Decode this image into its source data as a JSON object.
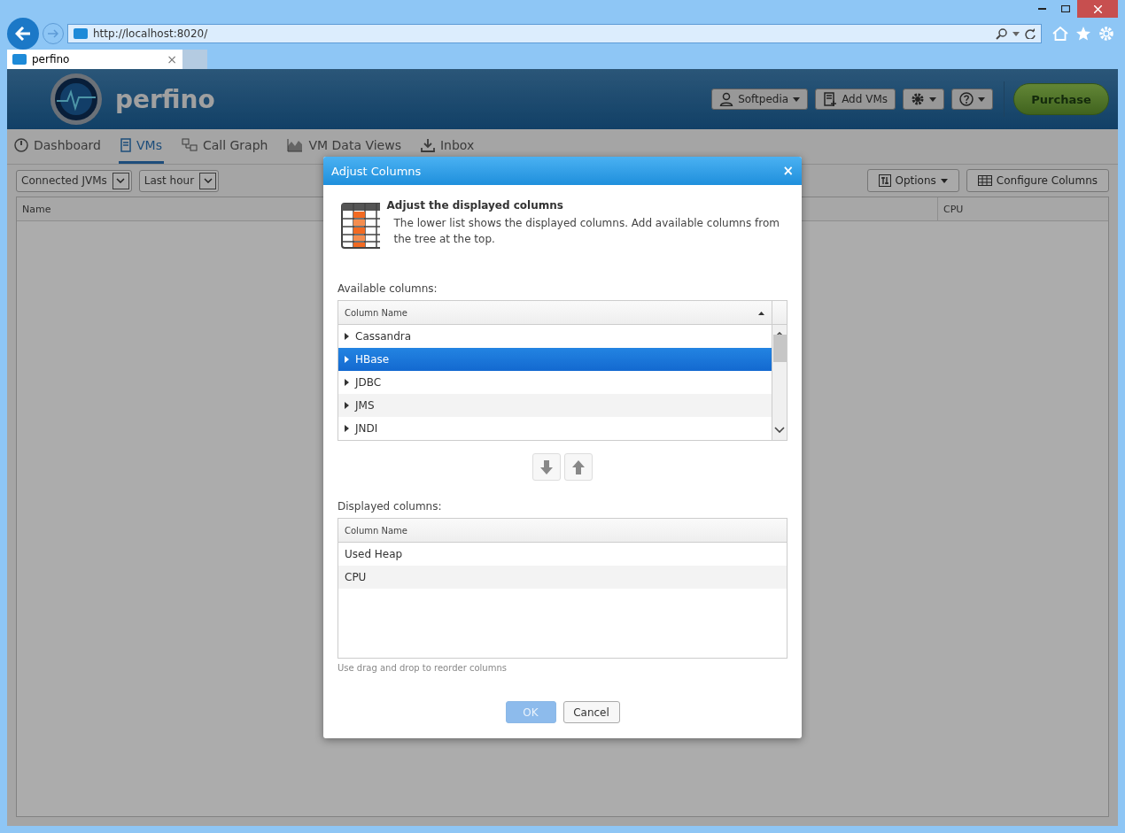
{
  "browser": {
    "address": "http://localhost:8020/",
    "tab": {
      "title": "perfino",
      "close": "×"
    }
  },
  "header": {
    "logo": "perfino",
    "buttons": [
      {
        "kind": "user",
        "label": "Softpedia",
        "dropdown": true
      },
      {
        "kind": "add",
        "label": "Add VMs",
        "dropdown": false
      },
      {
        "kind": "settings",
        "dropdown": true
      },
      {
        "kind": "help",
        "dropdown": true
      }
    ],
    "purchase": "Purchase"
  },
  "nav": [
    {
      "kind": "dashboard",
      "label": "Dashboard",
      "selected": false
    },
    {
      "kind": "vms",
      "label": "VMs",
      "selected": true
    },
    {
      "kind": "callgraph",
      "label": "Call Graph",
      "selected": false
    },
    {
      "kind": "dataviews",
      "label": "VM Data Views",
      "selected": false
    },
    {
      "kind": "inbox",
      "label": "Inbox",
      "selected": false
    }
  ],
  "toolbar": {
    "selects": [
      "Connected JVMs",
      "Last hour"
    ],
    "buttons": [
      {
        "kind": "options",
        "label": "Options",
        "dropdown": true
      },
      {
        "kind": "columns",
        "label": "Configure Columns",
        "dropdown": false
      }
    ]
  },
  "table": {
    "columns": [
      "Name",
      "CPU"
    ]
  },
  "dialog": {
    "title": "Adjust Columns",
    "close": "×",
    "heading": "Adjust the displayed columns",
    "description": "The lower list shows the displayed columns. Add available columns from the tree at the top.",
    "available": {
      "label": "Available columns:",
      "header": "Column Name",
      "rows": [
        {
          "label": "Cassandra",
          "selected": false,
          "expanded": false
        },
        {
          "label": "HBase",
          "selected": true,
          "expanded": false
        },
        {
          "label": "JDBC",
          "selected": false,
          "expanded": false
        },
        {
          "label": "JMS",
          "selected": false,
          "expanded": false
        },
        {
          "label": "JNDI",
          "selected": false,
          "expanded": false
        }
      ]
    },
    "displayed": {
      "label": "Displayed columns:",
      "header": "Column Name",
      "rows": [
        {
          "label": "Used Heap"
        },
        {
          "label": "CPU"
        }
      ]
    },
    "hint": "Use drag and drop to reorder columns",
    "ok": {
      "label": "OK",
      "disabled": true
    },
    "cancel": {
      "label": "Cancel"
    }
  }
}
